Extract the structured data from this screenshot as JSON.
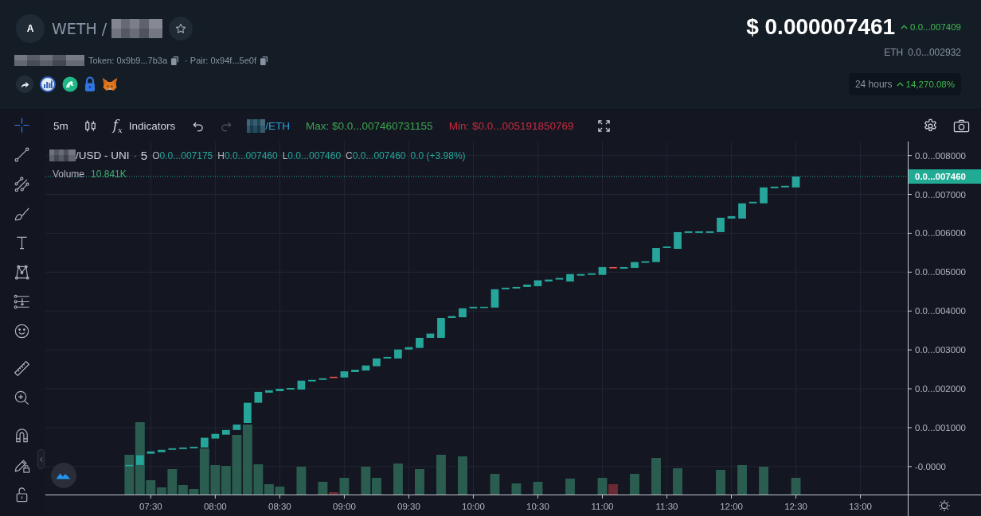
{
  "header": {
    "avatar": "A",
    "pair_base": "WETH /",
    "token_address": "Token: 0x9b9...7b3a",
    "pair_address": "· Pair: 0x94f...5e0f",
    "price": "$ 0.000007461",
    "price_change": {
      "up": true,
      "value": "0.0...007409"
    },
    "eth_label": "ETH",
    "eth_value": "0.0...002932",
    "period": {
      "label": "24 hours",
      "up": true,
      "value": "14,270.08%"
    }
  },
  "toolbar": {
    "interval": "5m",
    "indicators_glyph": "f$_{x}$",
    "indicators": "Indicators",
    "undo": {
      "disabled": false
    },
    "redo": {
      "disabled": true
    },
    "pair_suffix": "/ETH",
    "max": "Max: $0.0...007460731155",
    "min": "Min: $0.0...005191850769"
  },
  "tool_groups": [
    {
      "tools": [
        {
          "kind": "crosshair",
          "selected": true
        },
        {
          "kind": "trend-line",
          "selected": false
        },
        {
          "kind": "fork",
          "selected": false
        },
        {
          "kind": "brush",
          "selected": false
        },
        {
          "kind": "text",
          "selected": false
        },
        {
          "kind": "pattern",
          "selected": false
        },
        {
          "kind": "prediction",
          "selected": false
        },
        {
          "kind": "emoji",
          "selected": false
        }
      ]
    },
    {
      "tools": [
        {
          "kind": "ruler",
          "selected": false
        },
        {
          "kind": "zoom",
          "selected": false
        }
      ]
    },
    {
      "tools": [
        {
          "kind": "magnet",
          "selected": false
        },
        {
          "kind": "lock-drawings",
          "selected": false
        },
        {
          "kind": "lock",
          "selected": false
        }
      ]
    }
  ],
  "chart": {
    "legend": {
      "symbol": "/USD - UNI",
      "separator": "·",
      "interval": "5",
      "ohlc": [
        {
          "label": "O",
          "value": "0.0...007175"
        },
        {
          "label": "H",
          "value": "0.0...007460"
        },
        {
          "label": "L",
          "value": "0.0...007460"
        },
        {
          "label": "C",
          "value": "0.0...007460"
        }
      ],
      "change": "0.0 (+3.98%)"
    },
    "volume": {
      "label": "Volume",
      "value": "10.841K"
    },
    "price_axis": [
      "0.0...008000",
      "0.0...007000",
      "0.0...006000",
      "0.0...005000",
      "0.0...004000",
      "0.0...003000",
      "0.0...002000",
      "0.0...001000",
      "-0.0000"
    ],
    "last_price_label": "0.0...007460",
    "time_axis": [
      "07:30",
      "08:00",
      "08:30",
      "09:00",
      "09:30",
      "10:00",
      "10:30",
      "11:00",
      "11:30",
      "12:00",
      "12:30",
      "13:00"
    ]
  }
}
